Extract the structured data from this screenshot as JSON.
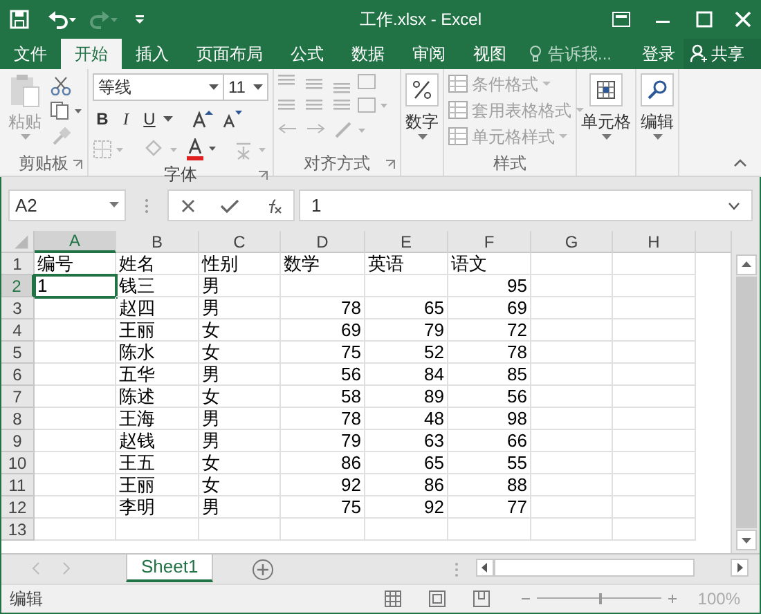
{
  "window": {
    "title": "工作.xlsx - Excel"
  },
  "tabs": [
    {
      "label": "文件",
      "selected": false
    },
    {
      "label": "开始",
      "selected": true
    },
    {
      "label": "插入",
      "selected": false
    },
    {
      "label": "页面布局",
      "selected": false
    },
    {
      "label": "公式",
      "selected": false
    },
    {
      "label": "数据",
      "selected": false
    },
    {
      "label": "审阅",
      "selected": false
    },
    {
      "label": "视图",
      "selected": false
    }
  ],
  "tell_me": {
    "placeholder": "告诉我..."
  },
  "account": {
    "sign_in": "登录",
    "share": "共享"
  },
  "ribbon": {
    "clipboard": {
      "paste": "粘贴",
      "label": "剪贴板",
      "disabled": true
    },
    "font": {
      "name": "等线",
      "size": "11",
      "bold": "B",
      "italic": "I",
      "underline": "U",
      "label": "字体"
    },
    "alignment": {
      "label": "对齐方式",
      "disabled": true
    },
    "number": {
      "button": "数字"
    },
    "styles": {
      "items": [
        {
          "label": "条件格式",
          "disabled": true
        },
        {
          "label": "套用表格格式",
          "disabled": true
        },
        {
          "label": "单元格样式",
          "disabled": true
        }
      ],
      "label": "样式"
    },
    "cells": {
      "button": "单元格"
    },
    "editing": {
      "button": "编辑"
    }
  },
  "formula_bar": {
    "name_box": "A2",
    "formula": "1"
  },
  "sheet": {
    "columns": [
      {
        "label": "A",
        "selected": true,
        "kind": "text"
      },
      {
        "label": "B",
        "selected": false,
        "kind": "text"
      },
      {
        "label": "C",
        "selected": false,
        "kind": "text"
      },
      {
        "label": "D",
        "selected": false,
        "kind": "number"
      },
      {
        "label": "E",
        "selected": false,
        "kind": "number"
      },
      {
        "label": "F",
        "selected": false,
        "kind": "number"
      },
      {
        "label": "G",
        "selected": false,
        "kind": "text"
      },
      {
        "label": "H",
        "selected": false,
        "kind": "text"
      }
    ],
    "rows": [
      {
        "number": "1",
        "selected": false,
        "kind": "header",
        "cells": [
          "编号",
          "姓名",
          "性别",
          "数学",
          "英语",
          "语文",
          null,
          null
        ]
      },
      {
        "number": "2",
        "selected": true,
        "cells": [
          "1",
          "钱三",
          "男",
          null,
          null,
          "95",
          null,
          null
        ]
      },
      {
        "number": "3",
        "selected": false,
        "cells": [
          null,
          "赵四",
          "男",
          "78",
          "65",
          "69",
          null,
          null
        ]
      },
      {
        "number": "4",
        "selected": false,
        "cells": [
          null,
          "王丽",
          "女",
          "69",
          "79",
          "72",
          null,
          null
        ]
      },
      {
        "number": "5",
        "selected": false,
        "cells": [
          null,
          "陈水",
          "女",
          "75",
          "52",
          "78",
          null,
          null
        ]
      },
      {
        "number": "6",
        "selected": false,
        "cells": [
          null,
          "五华",
          "男",
          "56",
          "84",
          "85",
          null,
          null
        ]
      },
      {
        "number": "7",
        "selected": false,
        "cells": [
          null,
          "陈述",
          "女",
          "58",
          "89",
          "56",
          null,
          null
        ]
      },
      {
        "number": "8",
        "selected": false,
        "cells": [
          null,
          "王海",
          "男",
          "78",
          "48",
          "98",
          null,
          null
        ]
      },
      {
        "number": "9",
        "selected": false,
        "cells": [
          null,
          "赵钱",
          "男",
          "79",
          "63",
          "66",
          null,
          null
        ]
      },
      {
        "number": "10",
        "selected": false,
        "cells": [
          null,
          "王五",
          "女",
          "86",
          "65",
          "55",
          null,
          null
        ]
      },
      {
        "number": "11",
        "selected": false,
        "cells": [
          null,
          "王丽",
          "女",
          "92",
          "86",
          "88",
          null,
          null
        ]
      },
      {
        "number": "12",
        "selected": false,
        "cells": [
          null,
          "李明",
          "男",
          "75",
          "92",
          "77",
          null,
          null
        ]
      },
      {
        "number": "13",
        "selected": false,
        "cells": [
          null,
          null,
          null,
          null,
          null,
          null,
          null,
          null
        ]
      }
    ]
  },
  "sheet_tabs": [
    {
      "label": "Sheet1",
      "selected": true
    }
  ],
  "status_bar": {
    "mode": "编辑",
    "zoom_slider": {
      "level": 0.5
    },
    "zoom": "100%"
  }
}
